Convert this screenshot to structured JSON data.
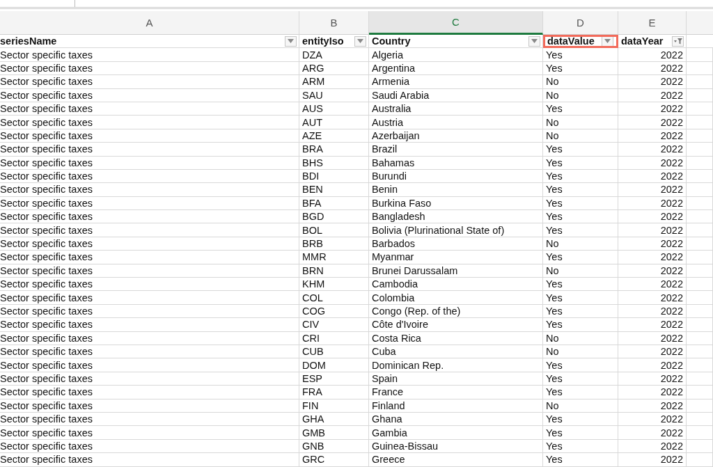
{
  "column_letters": [
    {
      "label": "A",
      "selected": false
    },
    {
      "label": "B",
      "selected": false
    },
    {
      "label": "C",
      "selected": true
    },
    {
      "label": "D",
      "selected": false
    },
    {
      "label": "E",
      "selected": false
    }
  ],
  "header": [
    {
      "label": "seriesName",
      "filtered": false,
      "highlighted": false
    },
    {
      "label": "entityIso",
      "filtered": false,
      "highlighted": false
    },
    {
      "label": "Country",
      "filtered": false,
      "highlighted": false
    },
    {
      "label": "dataValue",
      "filtered": false,
      "highlighted": true
    },
    {
      "label": "dataYear",
      "filtered": true,
      "highlighted": false
    }
  ],
  "columns": [
    {
      "kind": "text"
    },
    {
      "kind": "text"
    },
    {
      "kind": "text"
    },
    {
      "kind": "text"
    },
    {
      "kind": "number"
    }
  ],
  "rows": [
    {
      "cells": [
        "Sector specific taxes",
        "DZA",
        "Algeria",
        "Yes",
        "2022"
      ]
    },
    {
      "cells": [
        "Sector specific taxes",
        "ARG",
        "Argentina",
        "Yes",
        "2022"
      ]
    },
    {
      "cells": [
        "Sector specific taxes",
        "ARM",
        "Armenia",
        "No",
        "2022"
      ]
    },
    {
      "cells": [
        "Sector specific taxes",
        "SAU",
        "Saudi Arabia",
        "No",
        "2022"
      ]
    },
    {
      "cells": [
        "Sector specific taxes",
        "AUS",
        "Australia",
        "Yes",
        "2022"
      ]
    },
    {
      "cells": [
        "Sector specific taxes",
        "AUT",
        "Austria",
        "No",
        "2022"
      ]
    },
    {
      "cells": [
        "Sector specific taxes",
        "AZE",
        "Azerbaijan",
        "No",
        "2022"
      ]
    },
    {
      "cells": [
        "Sector specific taxes",
        "BRA",
        "Brazil",
        "Yes",
        "2022"
      ]
    },
    {
      "cells": [
        "Sector specific taxes",
        "BHS",
        "Bahamas",
        "Yes",
        "2022"
      ]
    },
    {
      "cells": [
        "Sector specific taxes",
        "BDI",
        "Burundi",
        "Yes",
        "2022"
      ]
    },
    {
      "cells": [
        "Sector specific taxes",
        "BEN",
        "Benin",
        "Yes",
        "2022"
      ]
    },
    {
      "cells": [
        "Sector specific taxes",
        "BFA",
        "Burkina Faso",
        "Yes",
        "2022"
      ]
    },
    {
      "cells": [
        "Sector specific taxes",
        "BGD",
        "Bangladesh",
        "Yes",
        "2022"
      ]
    },
    {
      "cells": [
        "Sector specific taxes",
        "BOL",
        "Bolivia (Plurinational State of)",
        "Yes",
        "2022"
      ]
    },
    {
      "cells": [
        "Sector specific taxes",
        "BRB",
        "Barbados",
        "No",
        "2022"
      ]
    },
    {
      "cells": [
        "Sector specific taxes",
        "MMR",
        "Myanmar",
        "Yes",
        "2022"
      ]
    },
    {
      "cells": [
        "Sector specific taxes",
        "BRN",
        "Brunei Darussalam",
        "No",
        "2022"
      ]
    },
    {
      "cells": [
        "Sector specific taxes",
        "KHM",
        "Cambodia",
        "Yes",
        "2022"
      ]
    },
    {
      "cells": [
        "Sector specific taxes",
        "COL",
        "Colombia",
        "Yes",
        "2022"
      ]
    },
    {
      "cells": [
        "Sector specific taxes",
        "COG",
        "Congo (Rep. of the)",
        "Yes",
        "2022"
      ]
    },
    {
      "cells": [
        "Sector specific taxes",
        "CIV",
        "Côte d'Ivoire",
        "Yes",
        "2022"
      ]
    },
    {
      "cells": [
        "Sector specific taxes",
        "CRI",
        "Costa Rica",
        "No",
        "2022"
      ]
    },
    {
      "cells": [
        "Sector specific taxes",
        "CUB",
        "Cuba",
        "No",
        "2022"
      ]
    },
    {
      "cells": [
        "Sector specific taxes",
        "DOM",
        "Dominican Rep.",
        "Yes",
        "2022"
      ]
    },
    {
      "cells": [
        "Sector specific taxes",
        "ESP",
        "Spain",
        "Yes",
        "2022"
      ]
    },
    {
      "cells": [
        "Sector specific taxes",
        "FRA",
        "France",
        "Yes",
        "2022"
      ]
    },
    {
      "cells": [
        "Sector specific taxes",
        "FIN",
        "Finland",
        "No",
        "2022"
      ]
    },
    {
      "cells": [
        "Sector specific taxes",
        "GHA",
        "Ghana",
        "Yes",
        "2022"
      ]
    },
    {
      "cells": [
        "Sector specific taxes",
        "GMB",
        "Gambia",
        "Yes",
        "2022"
      ]
    },
    {
      "cells": [
        "Sector specific taxes",
        "GNB",
        "Guinea-Bissau",
        "Yes",
        "2022"
      ]
    },
    {
      "cells": [
        "Sector specific taxes",
        "GRC",
        "Greece",
        "Yes",
        "2022"
      ]
    }
  ]
}
